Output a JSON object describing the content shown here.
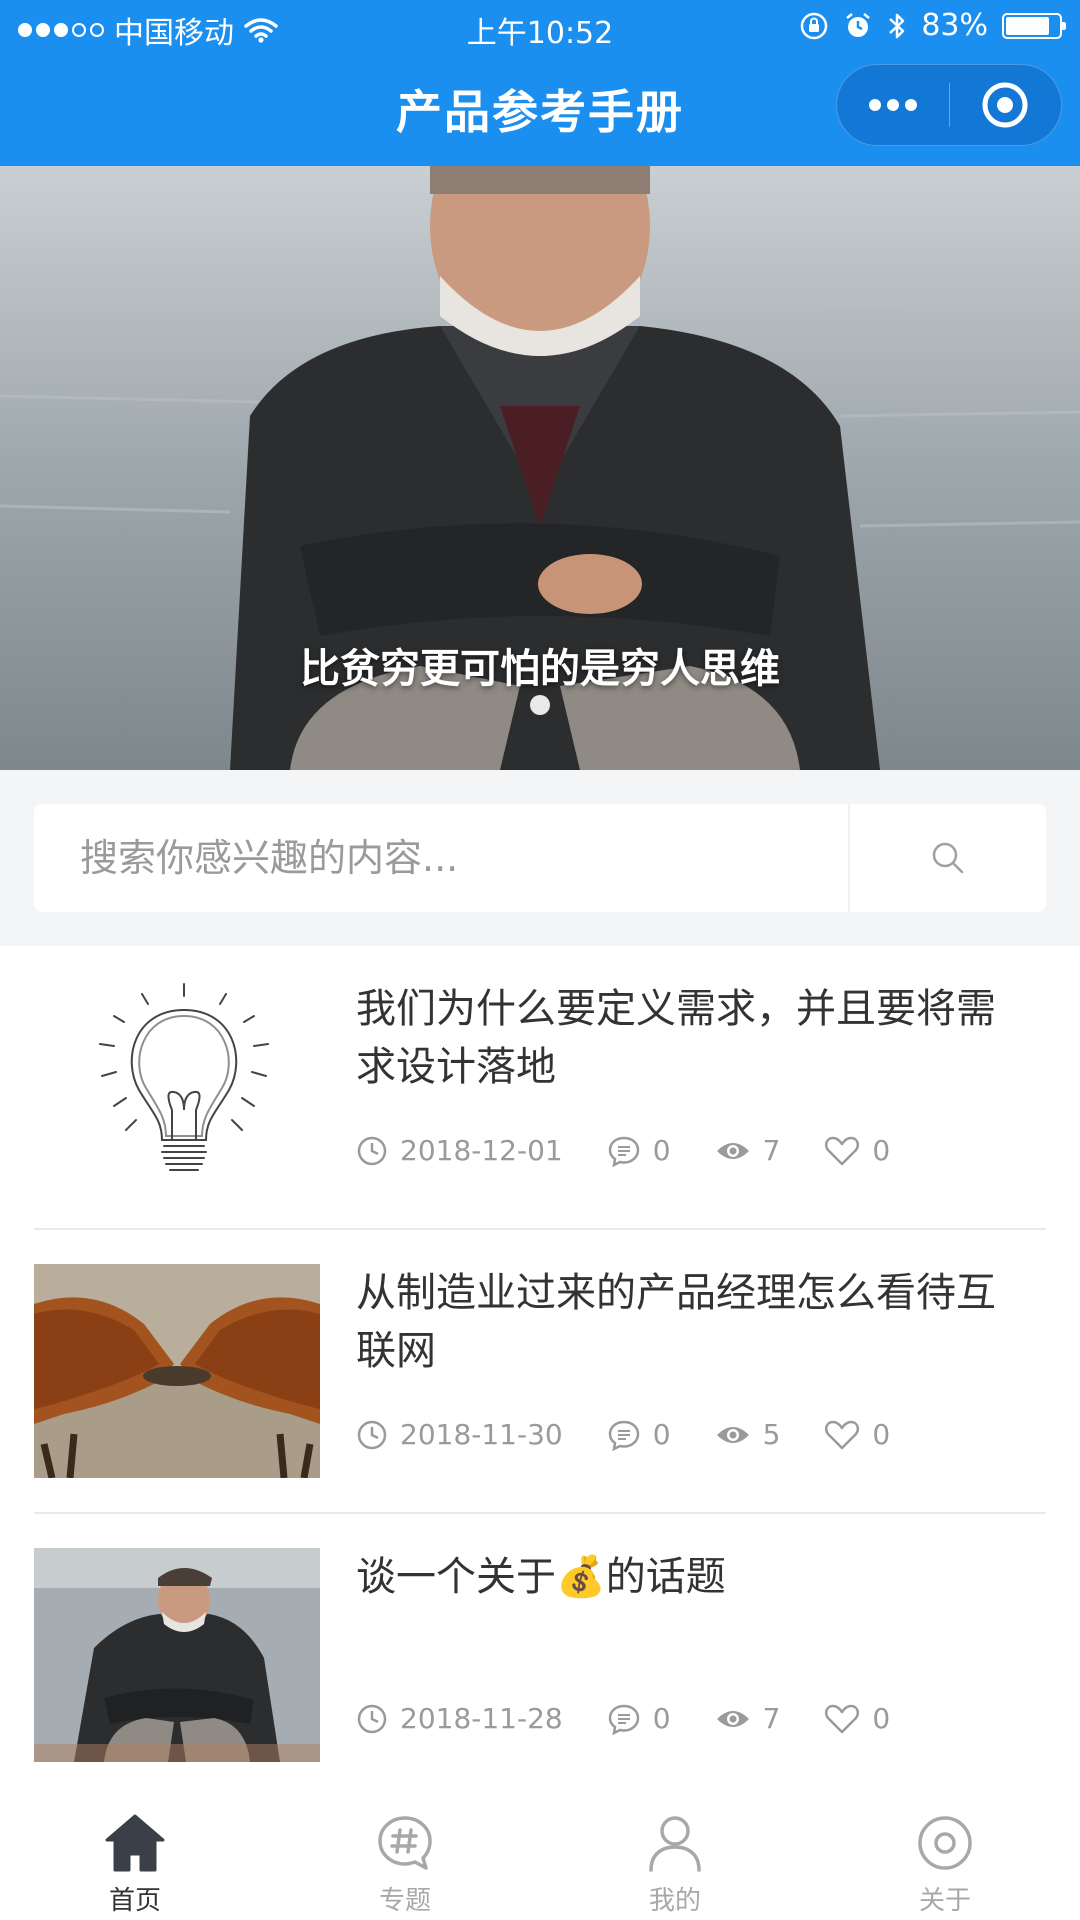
{
  "status_bar": {
    "carrier": "中国移动",
    "time": "上午10:52",
    "battery_percent_text": "83%",
    "battery_level": 0.83
  },
  "nav": {
    "title": "产品参考手册",
    "capsule_more_icon": "more-dots-icon",
    "capsule_close_icon": "target-circle-icon"
  },
  "banner": {
    "caption": "比贫穷更可怕的是穷人思维",
    "slide_count": 1,
    "active_index": 0
  },
  "search": {
    "placeholder": "搜索你感兴趣的内容..."
  },
  "articles": [
    {
      "title": "我们为什么要定义需求，并且要将需求设计落地",
      "date": "2018-12-01",
      "comments": "0",
      "views": "7",
      "likes": "0",
      "thumb_icon": "lightbulb-sketch-image"
    },
    {
      "title": "从制造业过来的产品经理怎么看待互联网",
      "date": "2018-11-30",
      "comments": "0",
      "views": "5",
      "likes": "0",
      "thumb_icon": "goats-head-butting-image"
    },
    {
      "title": "谈一个关于💰的话题",
      "date": "2018-11-28",
      "comments": "0",
      "views": "7",
      "likes": "0",
      "thumb_icon": "old-man-sitting-image"
    }
  ],
  "tabbar": [
    {
      "label": "首页",
      "icon": "home-icon",
      "active": true
    },
    {
      "label": "专题",
      "icon": "topic-hash-icon",
      "active": false
    },
    {
      "label": "我的",
      "icon": "user-icon",
      "active": false
    },
    {
      "label": "关于",
      "icon": "about-circle-icon",
      "active": false
    }
  ],
  "colors": {
    "brand": "#1b8ff0",
    "text": "#333333",
    "muted": "#9a9a9a"
  }
}
